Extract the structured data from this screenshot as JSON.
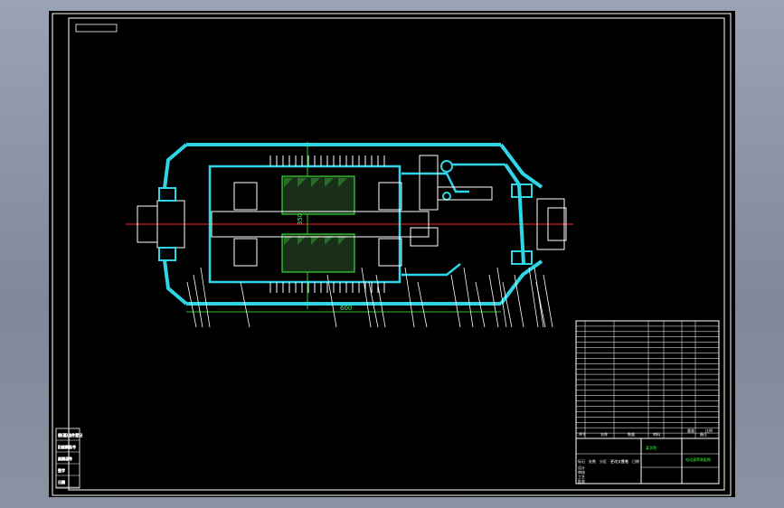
{
  "window": {
    "background": "#8a93a6",
    "viewport_background": "#000000"
  },
  "colors": {
    "frame": "#ffffff",
    "housing": "#2fd6e6",
    "centerline": "#ff2a2a",
    "dimension": "#39ff39",
    "parts": "#ffffff"
  },
  "drawing": {
    "dim_length": "600",
    "dim_diameter": "350",
    "balloon_count": 21
  },
  "title_block": {
    "header_cols": [
      "序号",
      "名称",
      "数量",
      "材料",
      "备注"
    ],
    "rows_count": 22,
    "company": "某学院",
    "drawing_title": "电动滚筒装配图",
    "weight_scale": [
      "重量",
      "比例"
    ],
    "left_strip": [
      "标记",
      "处数",
      "分区",
      "更改文件号",
      "签名",
      "日期"
    ],
    "approve": [
      "设计",
      "审核",
      "工艺",
      "批准"
    ]
  },
  "side_block": {
    "labels": [
      "借(通)用件登记",
      "旧底图总号",
      "底图总号",
      "签字",
      "日期"
    ]
  }
}
